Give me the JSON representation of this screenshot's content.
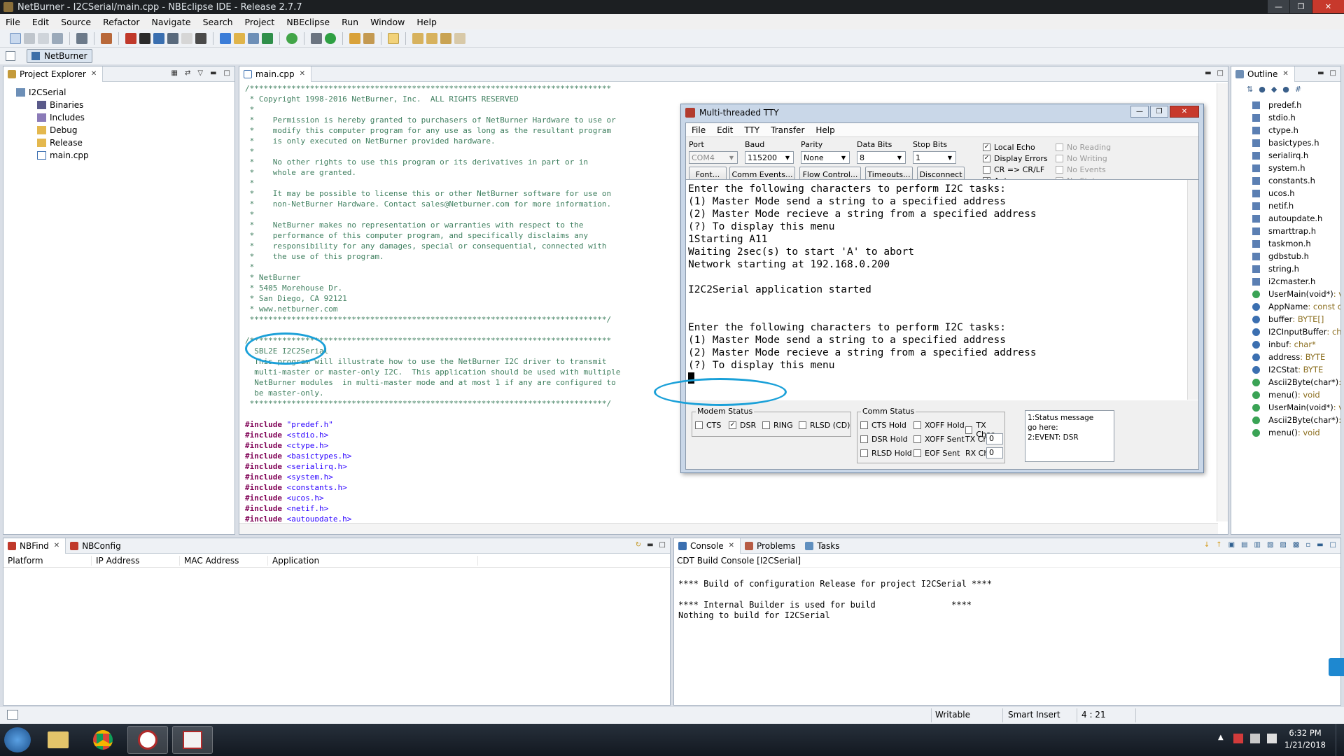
{
  "window": {
    "title": "NetBurner - I2CSerial/main.cpp - NBEclipse IDE - Release 2.7.7"
  },
  "menu": [
    "File",
    "Edit",
    "Source",
    "Refactor",
    "Navigate",
    "Search",
    "Project",
    "NBEclipse",
    "Run",
    "Window",
    "Help"
  ],
  "perspective": {
    "label": "NetBurner"
  },
  "project_explorer": {
    "title": "Project Explorer",
    "items": [
      {
        "label": "I2CSerial",
        "icon": "project-icon"
      },
      {
        "label": "Binaries",
        "icon": "binaries-icon"
      },
      {
        "label": "Includes",
        "icon": "includes-icon"
      },
      {
        "label": "Debug",
        "icon": "folder-icon"
      },
      {
        "label": "Release",
        "icon": "folder-icon"
      },
      {
        "label": "main.cpp",
        "icon": "file-icon"
      }
    ]
  },
  "editor": {
    "tab": "main.cpp",
    "comment_lines": [
      "/******************************************************************************",
      " * Copyright 1998-2016 NetBurner, Inc.  ALL RIGHTS RESERVED",
      " *",
      " *    Permission is hereby granted to purchasers of NetBurner Hardware to use or",
      " *    modify this computer program for any use as long as the resultant program",
      " *    is only executed on NetBurner provided hardware.",
      " *",
      " *    No other rights to use this program or its derivatives in part or in",
      " *    whole are granted.",
      " *",
      " *    It may be possible to license this or other NetBurner software for use on",
      " *    non-NetBurner Hardware. Contact sales@Netburner.com for more information.",
      " *",
      " *    NetBurner makes no representation or warranties with respect to the",
      " *    performance of this computer program, and specifically disclaims any",
      " *    responsibility for any damages, special or consequential, connected with",
      " *    the use of this program.",
      " *",
      " * NetBurner",
      " * 5405 Morehouse Dr.",
      " * San Diego, CA 92121",
      " * www.netburner.com",
      " *****************************************************************************/",
      "",
      "/******************************************************************************",
      "  SBL2E I2C2Serial",
      "  This program will illustrate how to use the NetBurner I2C driver to transmit",
      "  multi-master or master-only I2C.  This application should be used with multiple",
      "  NetBurner modules  in multi-master mode and at most 1 if any are configured to",
      "  be master-only.",
      " *****************************************************************************/",
      ""
    ],
    "includes": [
      "\"predef.h\"",
      "<stdio.h>",
      "<ctype.h>",
      "<basictypes.h>",
      "<serialirq.h>",
      "<system.h>",
      "<constants.h>",
      "<ucos.h>",
      "<netif.h>",
      "<autoupdate.h>"
    ],
    "include_kw": "#include"
  },
  "tty": {
    "title": "Multi-threaded TTY",
    "menu": [
      "File",
      "Edit",
      "TTY",
      "Transfer",
      "Help"
    ],
    "port_label": "Port",
    "port_value": "COM4",
    "baud_label": "Baud",
    "baud_value": "115200",
    "parity_label": "Parity",
    "parity_value": "None",
    "databits_label": "Data Bits",
    "databits_value": "8",
    "stopbits_label": "Stop Bits",
    "stopbits_value": "1",
    "buttons": [
      "Font...",
      "Comm Events...",
      "Flow Control...",
      "Timeouts...",
      "Disconnect"
    ],
    "options": [
      {
        "label": "Local Echo",
        "checked": true
      },
      {
        "label": "Display Errors",
        "checked": true
      },
      {
        "label": "CR => CR/LF",
        "checked": false
      },
      {
        "label": "Autowrap",
        "checked": true
      }
    ],
    "options_disabled": [
      "No Reading",
      "No Writing",
      "No Events",
      "No Status"
    ],
    "terminal_lines": [
      "Enter the following characters to perform I2C tasks:",
      "(1) Master Mode send a string to a specified address",
      "(2) Master Mode recieve a string from a specified address",
      "(?) To display this menu",
      "1Starting A11",
      "Waiting 2sec(s) to start 'A' to abort",
      "Network starting at 192.168.0.200",
      "",
      "I2C2Serial application started",
      "",
      "",
      "Enter the following characters to perform I2C tasks:",
      "(1) Master Mode send a string to a specified address",
      "(2) Master Mode recieve a string from a specified address",
      "(?) To display this menu"
    ],
    "modem_status": {
      "title": "Modem Status",
      "items": [
        {
          "label": "CTS",
          "checked": false
        },
        {
          "label": "DSR",
          "checked": true
        },
        {
          "label": "RING",
          "checked": false
        },
        {
          "label": "RLSD (CD)",
          "checked": false
        }
      ]
    },
    "comm_status": {
      "title": "Comm Status",
      "items": [
        "CTS Hold",
        "XOFF Hold",
        "TX Char",
        "DSR Hold",
        "XOFF Sent",
        "RLSD Hold",
        "EOF Sent"
      ],
      "tx_chars_label": "TX Chars:",
      "tx_chars_value": "0",
      "rx_chars_label": "RX Chars:",
      "rx_chars_value": "0"
    },
    "status_messages": [
      "1:Status message go here:",
      "2:EVENT: DSR"
    ]
  },
  "outline": {
    "title": "Outline",
    "items": [
      {
        "name": "predef.h",
        "type": ""
      },
      {
        "name": "stdio.h",
        "type": ""
      },
      {
        "name": "ctype.h",
        "type": ""
      },
      {
        "name": "basictypes.h",
        "type": ""
      },
      {
        "name": "serialirq.h",
        "type": ""
      },
      {
        "name": "system.h",
        "type": ""
      },
      {
        "name": "constants.h",
        "type": ""
      },
      {
        "name": "ucos.h",
        "type": ""
      },
      {
        "name": "netif.h",
        "type": ""
      },
      {
        "name": "autoupdate.h",
        "type": ""
      },
      {
        "name": "smarttrap.h",
        "type": ""
      },
      {
        "name": "taskmon.h",
        "type": ""
      },
      {
        "name": "gdbstub.h",
        "type": ""
      },
      {
        "name": "string.h",
        "type": ""
      },
      {
        "name": "i2cmaster.h",
        "type": ""
      },
      {
        "name": "UserMain(void*)",
        "type": " : v"
      },
      {
        "name": "AppName",
        "type": " : const c"
      },
      {
        "name": "buffer",
        "type": " : BYTE[]"
      },
      {
        "name": "I2CInputBuffer",
        "type": " : ch"
      },
      {
        "name": "inbuf",
        "type": " : char*"
      },
      {
        "name": "address",
        "type": " : BYTE"
      },
      {
        "name": "I2CStat",
        "type": " : BYTE"
      },
      {
        "name": "Ascii2Byte(char*)",
        "type": " :"
      },
      {
        "name": "menu()",
        "type": " : void"
      },
      {
        "name": "UserMain(void*)",
        "type": " : v"
      },
      {
        "name": "Ascii2Byte(char*)",
        "type": " :"
      },
      {
        "name": "menu()",
        "type": " : void"
      }
    ]
  },
  "nbfind": {
    "tabs": [
      "NBFind",
      "NBConfig"
    ],
    "columns": [
      "Platform",
      "IP Address",
      "MAC Address",
      "Application"
    ]
  },
  "console": {
    "tabs": [
      "Console",
      "Problems",
      "Tasks"
    ],
    "header": "CDT Build Console [I2CSerial]",
    "lines": [
      "**** Build of configuration Release for project I2CSerial ****",
      "",
      "**** Internal Builder is used for build               ****",
      "Nothing to build for I2CSerial"
    ]
  },
  "statusbar": {
    "writable": "Writable",
    "insert_mode": "Smart Insert",
    "position": "4 : 21"
  },
  "taskbar": {
    "time": "6:32 PM",
    "date": "1/21/2018"
  },
  "colors": {
    "annotation": "#1aa0d8",
    "comment": "#3f7f5f",
    "keyword": "#7f0055",
    "string": "#2a00ff"
  }
}
